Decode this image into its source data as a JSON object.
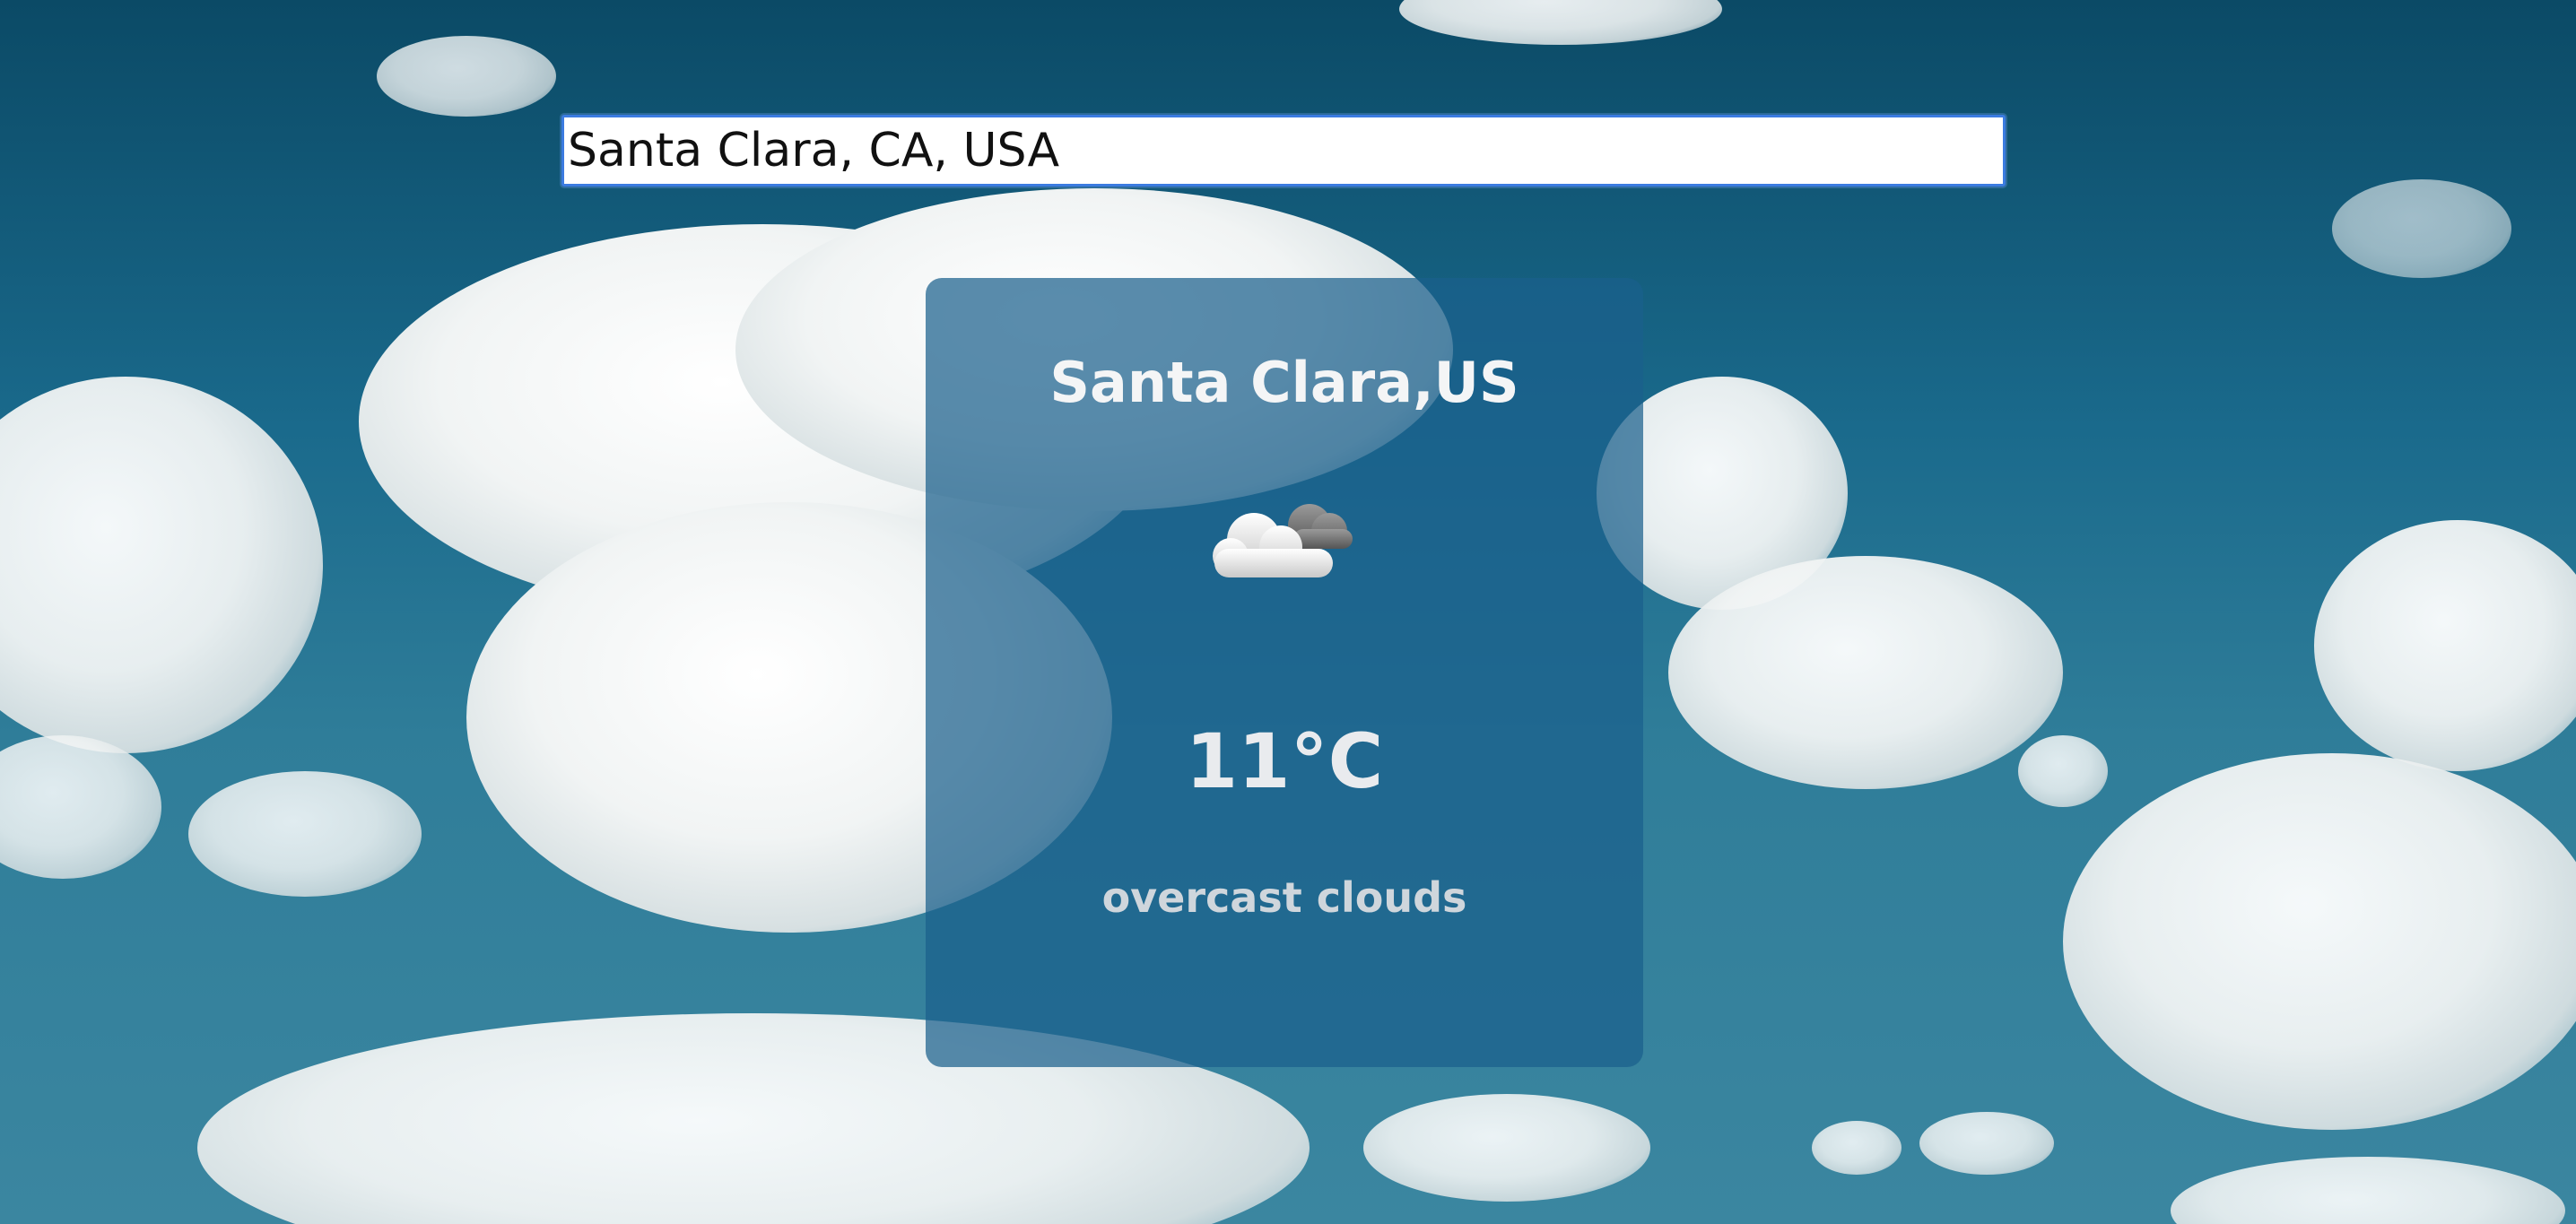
{
  "search": {
    "value": "Santa Clara, CA, USA"
  },
  "weather": {
    "location": "Santa Clara,US",
    "icon": "cloud-icon",
    "temperature": "11°C",
    "description": "overcast clouds"
  },
  "colors": {
    "sky": "#1a6a8c",
    "card": "#1a608c",
    "input_border": "#3b7be0"
  }
}
